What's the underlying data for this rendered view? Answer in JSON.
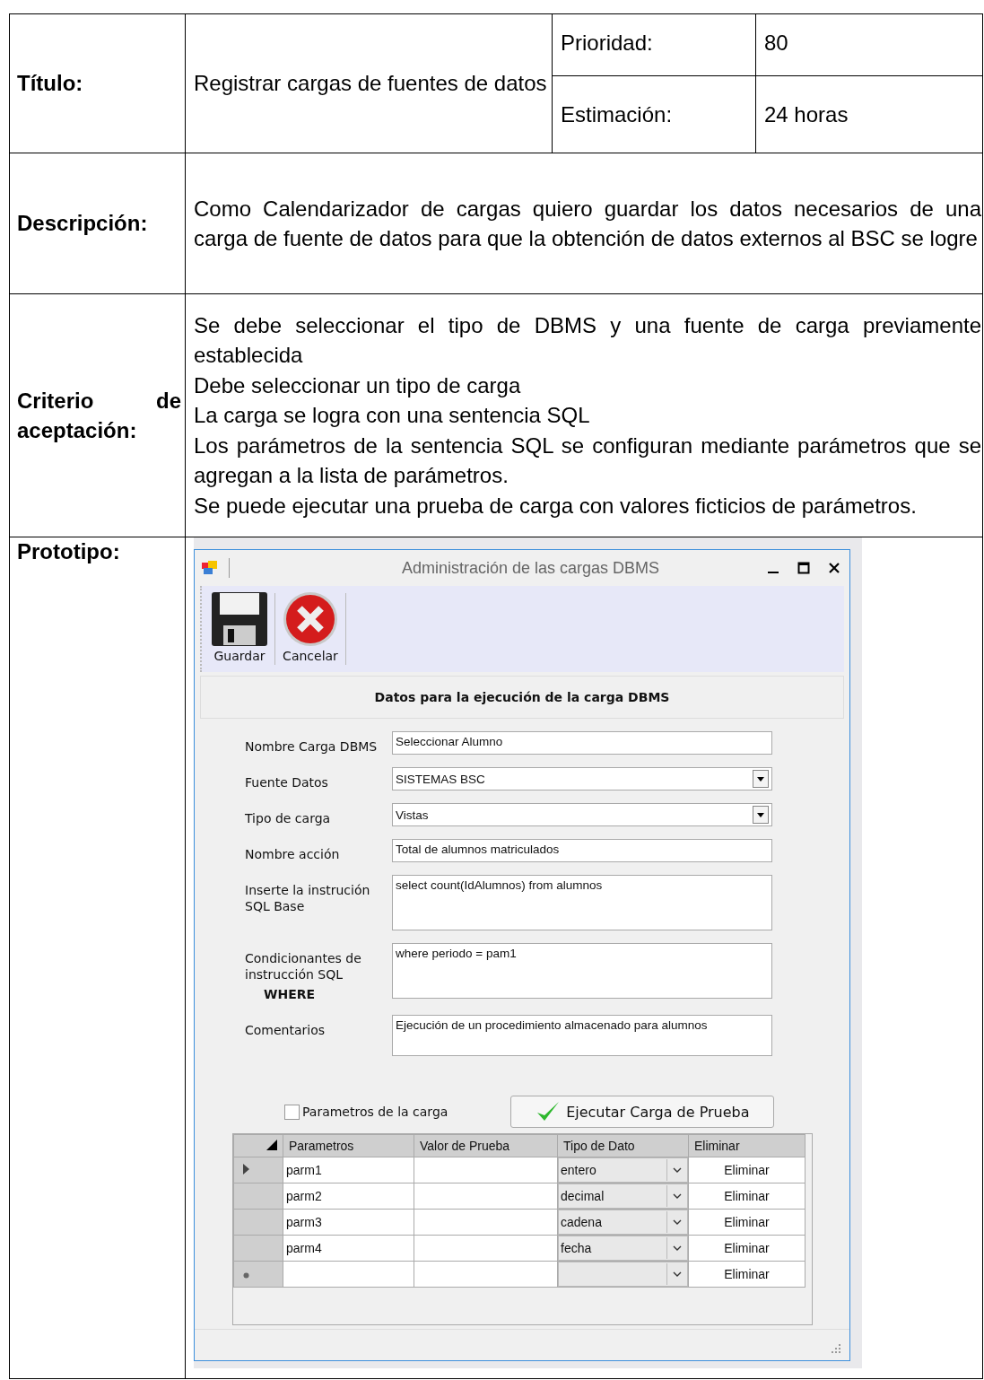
{
  "story": {
    "title_label": "Título:",
    "title": "Registrar cargas de fuentes de datos",
    "priority_label": "Prioridad:",
    "priority": "80",
    "estimate_label": "Estimación:",
    "estimate": "24 horas",
    "description_label": "Descripción:",
    "description": "Como Calendarizador de cargas quiero guardar los datos necesarios de una carga de fuente de datos para que la obtención de datos externos al BSC se logre",
    "criteria_label": "Criterio de aceptación:",
    "criteria": [
      "Se debe seleccionar el tipo de DBMS y una fuente de carga previamente establecida",
      "Debe seleccionar un tipo de carga",
      "La carga se logra con una sentencia SQL",
      "Los parámetros de la sentencia SQL se configuran mediante parámetros que se agregan a la lista de parámetros.",
      "Se puede ejecutar una prueba de carga con valores ficticios de parámetros."
    ],
    "prototype_label": "Prototipo:"
  },
  "window": {
    "title": "Administración de las cargas DBMS",
    "toolbar": [
      {
        "kind": "save",
        "label": "Guardar"
      },
      {
        "kind": "cancel",
        "label": "Cancelar"
      }
    ],
    "section_title": "Datos para la ejecución de la carga DBMS",
    "fields": [
      {
        "kind": "text",
        "label": "Nombre Carga DBMS",
        "value": "Seleccionar Alumno"
      },
      {
        "kind": "combo",
        "label": "Fuente Datos",
        "value": "SISTEMAS BSC"
      },
      {
        "kind": "combo",
        "label": "Tipo de carga",
        "value": "Vistas"
      },
      {
        "kind": "text",
        "label": "Nombre acción",
        "value": "Total de alumnos matriculados"
      },
      {
        "kind": "area",
        "label": "Inserte la instrución SQL Base",
        "value": "select count(IdAlumnos) from alumnos"
      },
      {
        "kind": "area",
        "label": "Condicionantes de instrucción SQL",
        "sublabel": "WHERE",
        "value": "where periodo = pam1"
      },
      {
        "kind": "memo",
        "label": "Comentarios",
        "value": "Ejecución de un procedimiento almacenado para alumnos"
      }
    ],
    "params_checkbox": {
      "label": "Parametros  de la carga",
      "checked": false
    },
    "test_button": "Ejecutar Carga de Prueba",
    "grid": {
      "columns": [
        "Parametros",
        "Valor de Prueba",
        "Tipo de Dato",
        "Eliminar"
      ],
      "rows": [
        {
          "kind": "current",
          "param": "parm1",
          "type": "entero",
          "action": "Eliminar"
        },
        {
          "kind": "normal",
          "param": "parm2",
          "type": "decimal",
          "action": "Eliminar"
        },
        {
          "kind": "normal",
          "param": "parm3",
          "type": "cadena",
          "action": "Eliminar"
        },
        {
          "kind": "normal",
          "param": "parm4",
          "type": "fecha",
          "action": "Eliminar"
        },
        {
          "kind": "new",
          "action": "Eliminar"
        }
      ]
    }
  }
}
